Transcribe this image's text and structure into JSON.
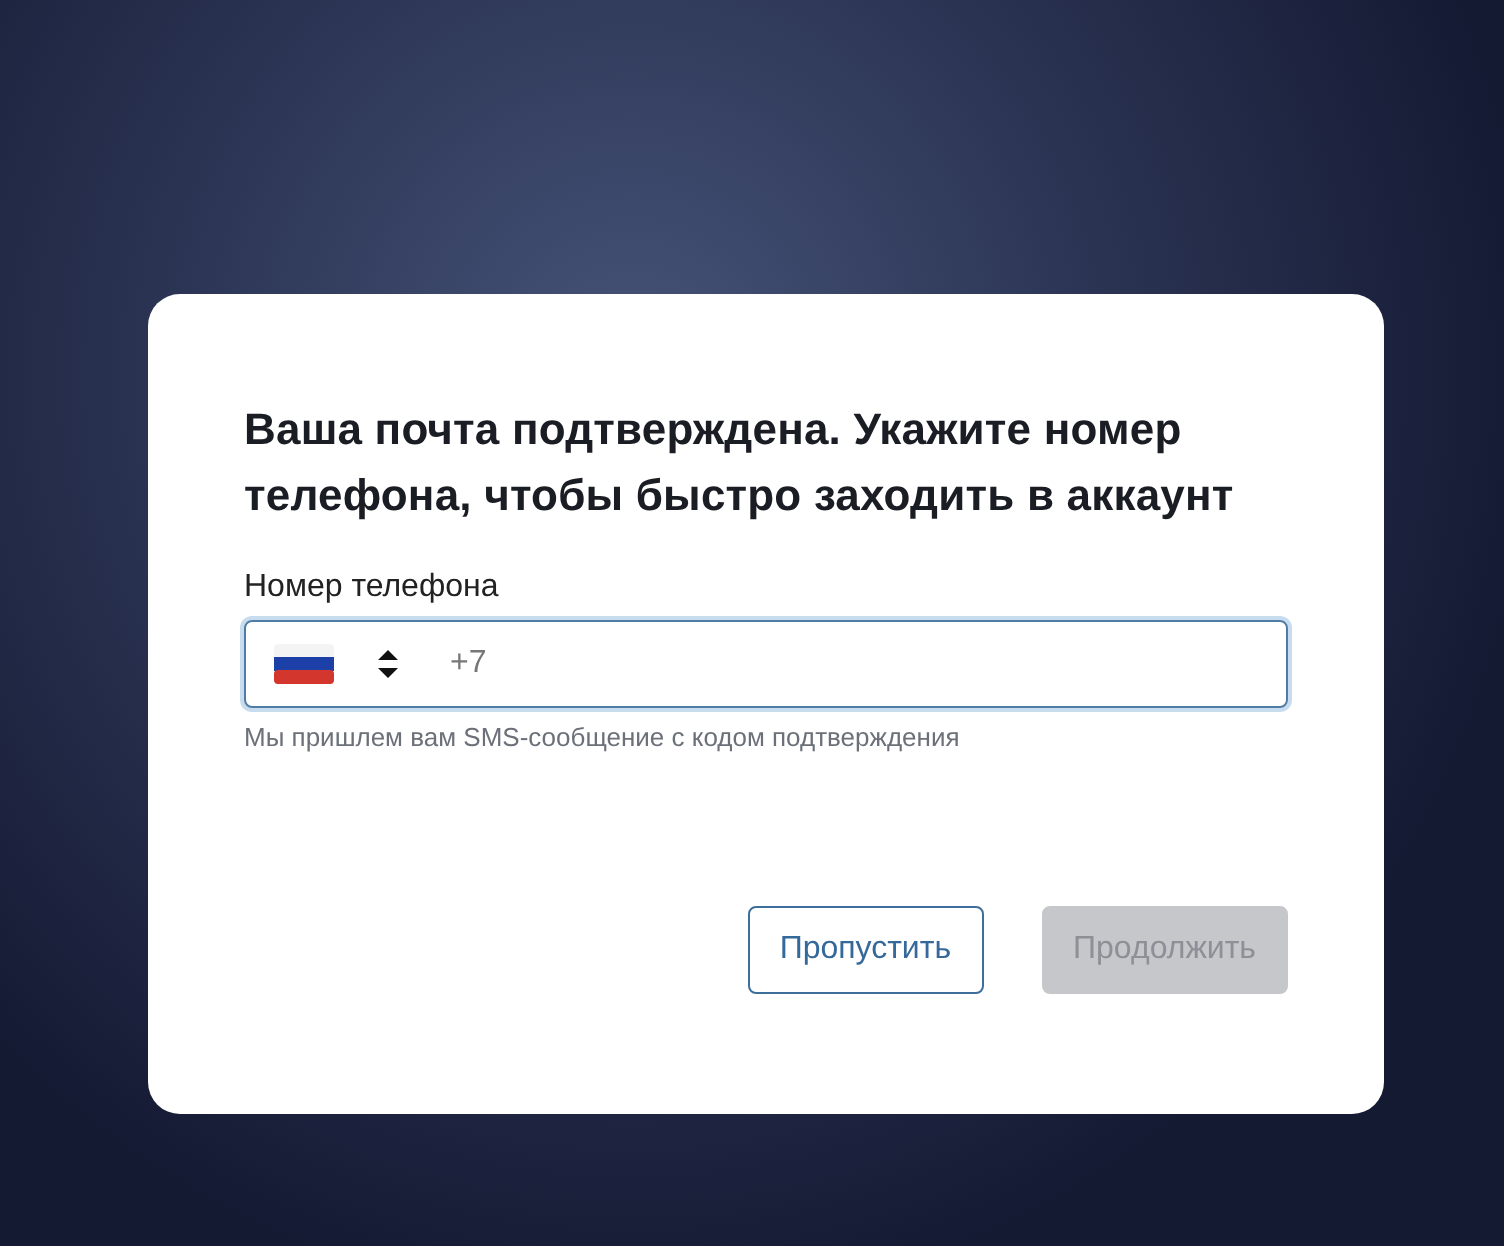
{
  "dialog": {
    "title": "Ваша почта подтверждена. Укажите номер телефона, чтобы быстро заходить в аккаунт",
    "phone_field": {
      "label": "Номер телефона",
      "placeholder": "+7",
      "hint": "Мы пришлем вам SMS-сообщение с кодом подтверждения",
      "focused": true
    },
    "buttons": [
      {
        "label": "Пропустить",
        "kind": "secondary",
        "disabled": false
      },
      {
        "label": "Продолжить",
        "kind": "primary",
        "disabled": true
      }
    ]
  }
}
